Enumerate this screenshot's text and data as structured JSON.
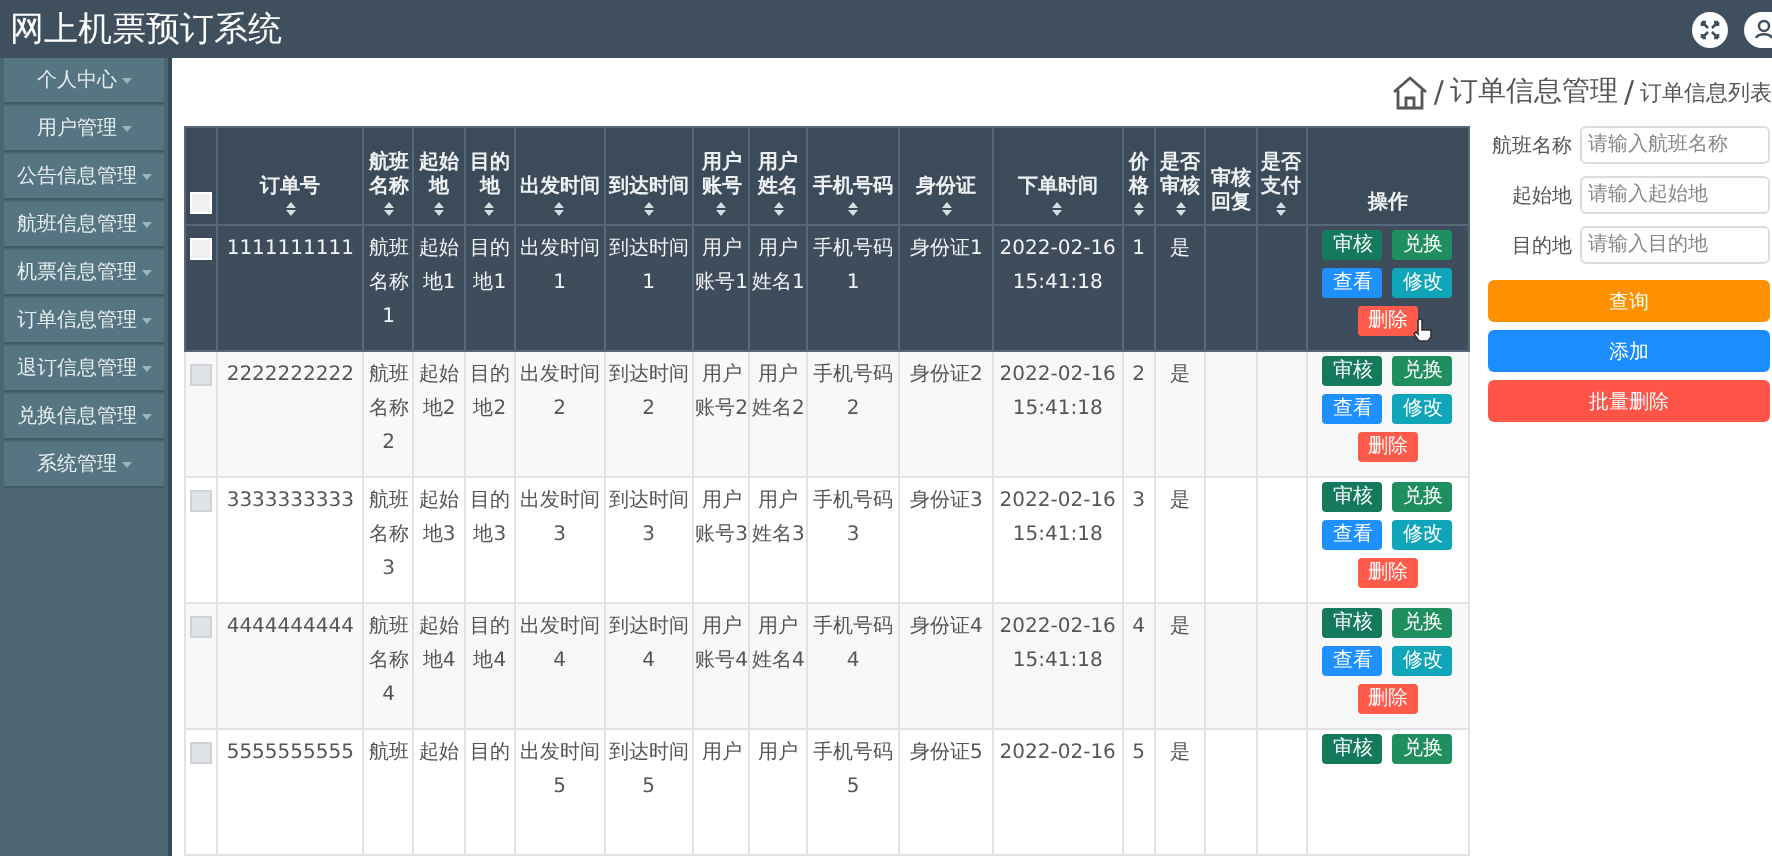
{
  "header": {
    "title": "网上机票预订系统"
  },
  "sidebar": {
    "items": [
      {
        "label": "个人中心"
      },
      {
        "label": "用户管理"
      },
      {
        "label": "公告信息管理"
      },
      {
        "label": "航班信息管理"
      },
      {
        "label": "机票信息管理"
      },
      {
        "label": "订单信息管理"
      },
      {
        "label": "退订信息管理"
      },
      {
        "label": "兑换信息管理"
      },
      {
        "label": "系统管理"
      }
    ]
  },
  "breadcrumb": {
    "separator": "/",
    "items": [
      "订单信息管理",
      "订单信息列表"
    ]
  },
  "table": {
    "header_checked": false,
    "columns": [
      {
        "label": "订单号",
        "sortable": true
      },
      {
        "label": "航班名称",
        "sortable": true
      },
      {
        "label": "起始地",
        "sortable": true
      },
      {
        "label": "目的地",
        "sortable": true
      },
      {
        "label": "出发时间",
        "sortable": true
      },
      {
        "label": "到达时间",
        "sortable": true
      },
      {
        "label": "用户账号",
        "sortable": true
      },
      {
        "label": "用户姓名",
        "sortable": true
      },
      {
        "label": "手机号码",
        "sortable": true
      },
      {
        "label": "身份证",
        "sortable": true
      },
      {
        "label": "下单时间",
        "sortable": true
      },
      {
        "label": "价格",
        "sortable": true
      },
      {
        "label": "是否审核",
        "sortable": true
      },
      {
        "label": "审核回复",
        "sortable": false
      },
      {
        "label": "是否支付",
        "sortable": true
      },
      {
        "label": "操作",
        "sortable": false
      }
    ],
    "rows": [
      {
        "highlighted": true,
        "checked": false,
        "cells": [
          "1111111111",
          "航班名称1",
          "起始地1",
          "目的地1",
          "出发时间1",
          "到达时间1",
          "用户账号1",
          "用户姓名1",
          "手机号码1",
          "身份证1",
          "2022-02-16 15:41:18",
          "1",
          "是"
        ],
        "actions": [
          {
            "label": "审核",
            "kind": "audit"
          },
          {
            "label": "兑换",
            "kind": "exchange"
          },
          {
            "label": "查看",
            "kind": "view"
          },
          {
            "label": "修改",
            "kind": "edit"
          },
          {
            "label": "删除",
            "kind": "delete"
          }
        ]
      },
      {
        "highlighted": false,
        "checked": false,
        "cells": [
          "2222222222",
          "航班名称2",
          "起始地2",
          "目的地2",
          "出发时间2",
          "到达时间2",
          "用户账号2",
          "用户姓名2",
          "手机号码2",
          "身份证2",
          "2022-02-16 15:41:18",
          "2",
          "是"
        ],
        "actions": [
          {
            "label": "审核",
            "kind": "audit"
          },
          {
            "label": "兑换",
            "kind": "exchange"
          },
          {
            "label": "查看",
            "kind": "view"
          },
          {
            "label": "修改",
            "kind": "edit"
          },
          {
            "label": "删除",
            "kind": "delete"
          }
        ]
      },
      {
        "highlighted": false,
        "checked": false,
        "cells": [
          "3333333333",
          "航班名称3",
          "起始地3",
          "目的地3",
          "出发时间3",
          "到达时间3",
          "用户账号3",
          "用户姓名3",
          "手机号码3",
          "身份证3",
          "2022-02-16 15:41:18",
          "3",
          "是"
        ],
        "actions": [
          {
            "label": "审核",
            "kind": "audit"
          },
          {
            "label": "兑换",
            "kind": "exchange"
          },
          {
            "label": "查看",
            "kind": "view"
          },
          {
            "label": "修改",
            "kind": "edit"
          },
          {
            "label": "删除",
            "kind": "delete"
          }
        ]
      },
      {
        "highlighted": false,
        "checked": false,
        "cells": [
          "4444444444",
          "航班名称4",
          "起始地4",
          "目的地4",
          "出发时间4",
          "到达时间4",
          "用户账号4",
          "用户姓名4",
          "手机号码4",
          "身份证4",
          "2022-02-16 15:41:18",
          "4",
          "是"
        ],
        "actions": [
          {
            "label": "审核",
            "kind": "audit"
          },
          {
            "label": "兑换",
            "kind": "exchange"
          },
          {
            "label": "查看",
            "kind": "view"
          },
          {
            "label": "修改",
            "kind": "edit"
          },
          {
            "label": "删除",
            "kind": "delete"
          }
        ]
      },
      {
        "highlighted": false,
        "checked": false,
        "cells": [
          "5555555555",
          "航班",
          "起始",
          "目的",
          "出发时间5",
          "到达时间5",
          "用户",
          "用户",
          "手机号码5",
          "身份证5",
          "2022-02-16",
          "5",
          "是"
        ],
        "actions": [
          {
            "label": "审核",
            "kind": "audit"
          },
          {
            "label": "兑换",
            "kind": "exchange"
          }
        ]
      }
    ]
  },
  "search": {
    "fields": [
      {
        "label": "航班名称",
        "placeholder": "请输入航班名称"
      },
      {
        "label": "起始地",
        "placeholder": "请输入起始地"
      },
      {
        "label": "目的地",
        "placeholder": "请输入目的地"
      }
    ],
    "buttons": [
      {
        "label": "查询",
        "kind": "search"
      },
      {
        "label": "添加",
        "kind": "add"
      },
      {
        "label": "批量删除",
        "kind": "delete"
      }
    ]
  }
}
